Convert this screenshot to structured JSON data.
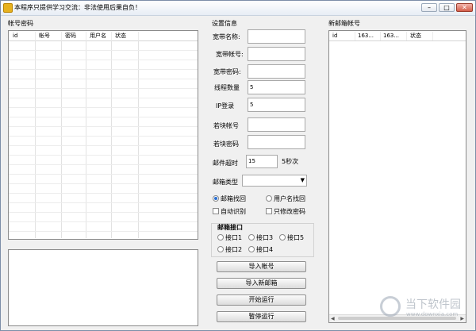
{
  "window": {
    "title": "本程序只提供学习交流：非法使用后果自负！",
    "controls": {
      "minimize": "–",
      "maximize": "□",
      "close": "✕"
    }
  },
  "accounts_panel": {
    "label": "帐号密码",
    "columns": [
      "id",
      "帐号",
      "密码",
      "用户名",
      "状态"
    ]
  },
  "settings": {
    "label": "设置信息",
    "broadband_name": {
      "label": "宽带名称:",
      "value": ""
    },
    "broadband_account": {
      "label": "宽带帐号:",
      "value": ""
    },
    "broadband_password": {
      "label": "宽带密码:",
      "value": ""
    },
    "thread_count": {
      "label": "线程数量",
      "value": "5"
    },
    "ip_login": {
      "label": "IP登录",
      "value": "5"
    },
    "fast_account": {
      "label": "若块帐号",
      "value": ""
    },
    "fast_password": {
      "label": "若块密码",
      "value": ""
    },
    "mail_timeout": {
      "label": "邮件超时",
      "value": "15",
      "unit": "5秒次"
    },
    "mailbox_type": {
      "label": "邮箱类型",
      "value": ""
    },
    "retrieve_mode": {
      "options": [
        "邮箱找回",
        "用户名找回"
      ],
      "selected": 0
    },
    "auto_recognize": {
      "label": "自动识别",
      "checked": false
    },
    "only_change_password": {
      "label": "只修改密码",
      "checked": false
    },
    "mail_interface": {
      "label": "邮箱接口",
      "options": [
        "接口1",
        "接口3",
        "接口5",
        "接口2",
        "接口4"
      ]
    }
  },
  "actions": {
    "import_accounts": "导入帐号",
    "import_new_mailbox": "导入新邮箱",
    "start": "开始运行",
    "pause": "暂停运行"
  },
  "new_mail_panel": {
    "label": "新邮箱帐号",
    "columns": [
      "id",
      "163...",
      "163...",
      "状态"
    ]
  },
  "watermark": {
    "text": "当下软件园",
    "subtext": "www.downxia.com"
  }
}
